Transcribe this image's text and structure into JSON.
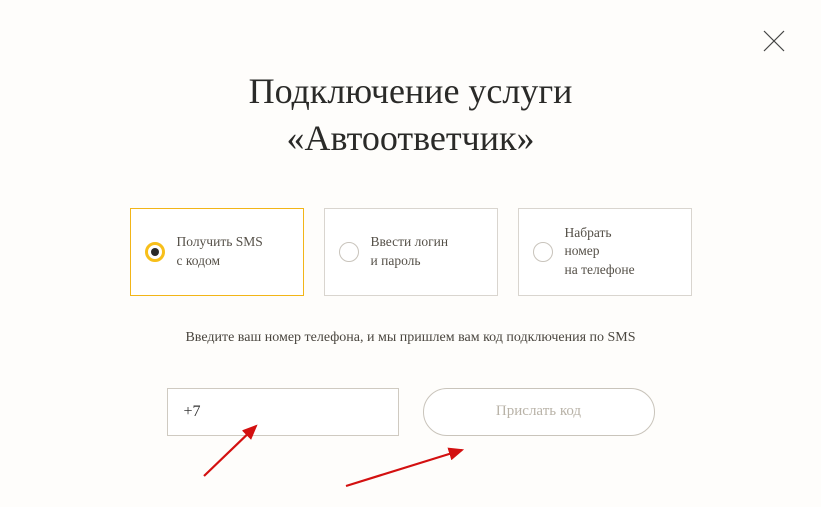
{
  "title": {
    "line1": "Подключение услуги",
    "line2": "«Автоответчик»"
  },
  "options": [
    {
      "label": "Получить SMS\nс кодом",
      "selected": true
    },
    {
      "label": "Ввести логин\nи пароль",
      "selected": false
    },
    {
      "label": "Набрать\nномер\nна телефоне",
      "selected": false
    }
  ],
  "instruction": "Введите ваш номер телефона, и мы пришлем вам код подключения по SMS",
  "phone": {
    "value": "+7"
  },
  "button": {
    "label": "Прислать код"
  }
}
